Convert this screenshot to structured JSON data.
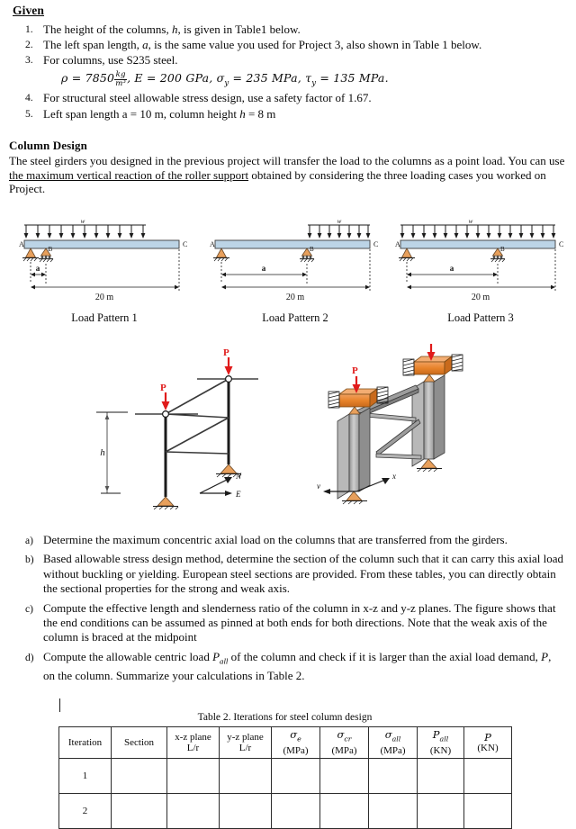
{
  "given": {
    "heading": "Given",
    "items": [
      {
        "n": "1.",
        "html_key": "i1"
      },
      {
        "n": "2.",
        "html_key": "i2"
      },
      {
        "n": "3.",
        "html_key": "i3"
      },
      {
        "n": "4.",
        "html_key": "i4"
      },
      {
        "n": "5.",
        "html_key": "i5"
      }
    ],
    "i1_a": "The height of the columns, ",
    "i1_h": "h",
    "i1_b": ", is given in Table1 below.",
    "i2_a": "The left span length, ",
    "i2_a2": "a",
    "i2_b": ", is the same value you used for Project 3, also shown in Table 1 below.",
    "i3": "For columns, use S235 steel.",
    "i4": "For structural steel allowable stress design, use a safety factor of 1.67.",
    "i5_a": "Left span length a = 10 m, column height ",
    "i5_h": "h",
    "i5_b": " = 8 m",
    "formula": {
      "rho": "ρ = 7850",
      "frac_num": "kg",
      "frac_den": "m³",
      "rest": ", E = 200 GPa, σ",
      "sub_y": "y",
      "rest2": " = 235 MPa, τ",
      "sub_y2": "y",
      "rest3": " = 135 MPa."
    }
  },
  "column_design": {
    "heading": "Column Design",
    "p1": "The steel girders you designed in the previous project will transfer the load to the columns as a point load. You can use ",
    "p1_underlined": "the maximum vertical reaction of the roller support",
    "p2": " obtained by considering the three loading cases you worked on Project."
  },
  "figures": {
    "beams": [
      {
        "caption": "Load Pattern 1",
        "label_w": "w",
        "label_A": "A",
        "label_B": "B",
        "label_C": "C",
        "label_a": "a",
        "span": "20 m",
        "load_start": 0.0,
        "load_end": 0.72
      },
      {
        "caption": "Load Pattern 2",
        "label_w": "w",
        "label_A": "A",
        "label_B": "B",
        "label_C": "C",
        "label_a": "a",
        "span": "20 m",
        "load_start": 0.7,
        "load_end": 1.0
      },
      {
        "caption": "Load Pattern 3",
        "label_w": "w",
        "label_A": "A",
        "label_B": "B",
        "label_C": "C",
        "label_a": "a",
        "span": "20 m",
        "load_start": 0.0,
        "load_end": 1.0
      }
    ],
    "frame2d": {
      "load_label": "P",
      "height_label": "h",
      "axis_up": "N",
      "axis_right": "E"
    },
    "frame3d": {
      "load_label": "P",
      "axis_x": "x",
      "axis_y": "v"
    }
  },
  "questions": [
    {
      "n": "a)",
      "text": "Determine the maximum concentric axial load on the columns that are transferred from the girders."
    },
    {
      "n": "b)",
      "text": "Based allowable stress design method, determine the section of the column such that it can carry this axial load without buckling or yielding. European steel sections are provided. From these tables, you can directly obtain the sectional properties for the strong and weak axis."
    },
    {
      "n": "c)",
      "text": "Compute the effective length and slenderness ratio of the column in x-z and y-z planes. The figure shows that the end conditions can be assumed as pinned at both ends for both directions. Note that the weak axis of the column is braced at the midpoint"
    },
    {
      "n": "d)",
      "d_a": "Compute the allowable centric load ",
      "d_P": "P",
      "d_sub": "all",
      "d_b": " of the column and check if it is larger than the axial load demand, ",
      "d_P2": "P",
      "d_c": ", on the column. Summarize your calculations in Table 2."
    }
  ],
  "table": {
    "caption": "Table 2. Iterations for steel column design",
    "headers": [
      {
        "l1": "Iteration",
        "l2": ""
      },
      {
        "l1": "Section",
        "l2": ""
      },
      {
        "l1": "x-z plane",
        "l2": "L/r"
      },
      {
        "l1": "y-z plane",
        "l2": "L/r"
      },
      {
        "l1": "σe",
        "l2": "(MPa)"
      },
      {
        "l1": "σcr",
        "l2": "(MPa)"
      },
      {
        "l1": "σall",
        "l2": "(MPa)"
      },
      {
        "l1": "Pall",
        "l2": "(KN)"
      },
      {
        "l1": "P",
        "l2": "(KN)"
      }
    ],
    "rows": [
      {
        "iteration": "1",
        "cells": [
          "",
          "",
          "",
          "",
          "",
          "",
          "",
          ""
        ]
      },
      {
        "iteration": "2",
        "cells": [
          "",
          "",
          "",
          "",
          "",
          "",
          "",
          ""
        ]
      }
    ]
  },
  "colors": {
    "beam_fill": "#bcd4e6",
    "beam_stroke": "#3a3a3a",
    "support_fill": "#e8a05c",
    "load_arrow": "#e01b1b",
    "girder_fill": "#e8832a",
    "steel_fill": "#a9a9a9"
  }
}
